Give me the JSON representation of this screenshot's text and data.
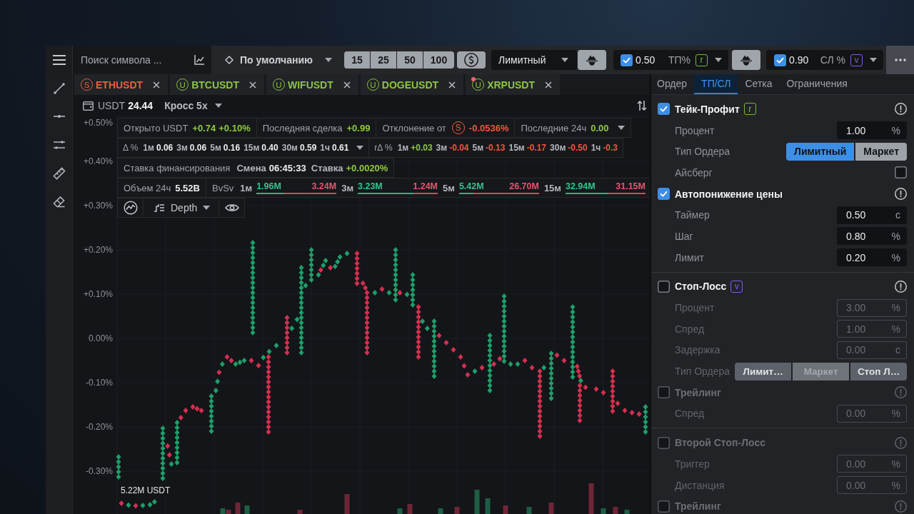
{
  "toolbar": {
    "search": {
      "placeholder": "Поиск символа ..."
    },
    "preset": {
      "label": "По умолчанию"
    },
    "leverage": [
      {
        "label": "15"
      },
      {
        "label": "25"
      },
      {
        "label": "50"
      },
      {
        "label": "100"
      }
    ],
    "order_type": {
      "value": "Лимитный"
    },
    "targets": [
      {
        "checked": true,
        "value": "0.50",
        "label": "ТП%",
        "key": "r",
        "color": "#74b83f"
      },
      {
        "checked": true,
        "value": "0.90",
        "label": "СЛ %",
        "key": "v",
        "color": "#7f5ee8"
      }
    ]
  },
  "chart_tabs": [
    {
      "market": "S",
      "symbol": "ETHUSDT",
      "color": "#f05d3b",
      "alert": false
    },
    {
      "market": "U",
      "symbol": "BTCUSDT",
      "color": "#8cc63e",
      "alert": false
    },
    {
      "market": "U",
      "symbol": "WIFUSDT",
      "color": "#8cc63e",
      "alert": false
    },
    {
      "market": "U",
      "symbol": "DOGEUSDT",
      "color": "#8cc63e",
      "alert": false
    },
    {
      "market": "U",
      "symbol": "XRPUSDT",
      "color": "#8cc63e",
      "alert": true
    }
  ],
  "chart": {
    "balance": {
      "currency": "USDT",
      "value": "24.44"
    },
    "margin_mode": "Кросс 5x",
    "stats": [
      [
        {
          "kind": "value",
          "label": "Открыто USDT",
          "values": [
            {
              "text": "+0.74",
              "kind": "up"
            },
            {
              "text": "+0.10%",
              "kind": "up"
            }
          ],
          "dropdown": false
        },
        {
          "kind": "value",
          "label": "Последняя сделка",
          "values": [
            {
              "text": "+0.99",
              "kind": "up"
            }
          ],
          "dropdown": false
        },
        {
          "kind": "value",
          "label": "Отклонение от",
          "market": "S",
          "values": [
            {
              "text": "-0.0536%",
              "kind": "down"
            }
          ],
          "dropdown": false
        },
        {
          "kind": "value",
          "label": "Последние 24ч",
          "values": [
            {
              "text": "0.00",
              "kind": "up"
            }
          ],
          "dropdown": true
        }
      ],
      [
        {
          "kind": "periods",
          "label": "Δ %",
          "items": [
            {
              "period": "1м",
              "value": "0.06",
              "kind": "flat"
            },
            {
              "period": "3м",
              "value": "0.06",
              "kind": "flat"
            },
            {
              "period": "5м",
              "value": "0.16",
              "kind": "flat"
            },
            {
              "period": "15м",
              "value": "0.40",
              "kind": "flat"
            },
            {
              "period": "30м",
              "value": "0.59",
              "kind": "flat"
            },
            {
              "period": "1ч",
              "value": "0.61",
              "kind": "flat"
            }
          ],
          "dropdown": true
        },
        {
          "kind": "periods",
          "label": "rΔ %",
          "items": [
            {
              "period": "1м",
              "value": "+0.03",
              "kind": "up"
            },
            {
              "period": "3м",
              "value": "-0.04",
              "kind": "down"
            },
            {
              "period": "5м",
              "value": "-0.13",
              "kind": "down"
            },
            {
              "period": "15м",
              "value": "-0.17",
              "kind": "down"
            },
            {
              "period": "30м",
              "value": "-0.50",
              "kind": "down"
            },
            {
              "period": "1ч",
              "value": "-0.3",
              "kind": "down"
            }
          ],
          "dropdown": false
        }
      ],
      [
        {
          "kind": "periods",
          "label": "Ставка финансирования",
          "items": [
            {
              "period": "Смена",
              "value": "06:45:33",
              "kind": "flat"
            },
            {
              "period": "Ставка",
              "value": "+0.0020%",
              "kind": "up"
            }
          ],
          "dropdown": false
        }
      ],
      [
        {
          "kind": "value",
          "label": "Объем 24ч",
          "values": [
            {
              "text": "5.52B",
              "kind": "flat"
            }
          ],
          "dropdown": false
        },
        {
          "kind": "ratio",
          "label": "BvSv",
          "items": [
            {
              "period": "1м",
              "buy": "1.96M",
              "sell": "3.24M",
              "level": 0.35
            },
            {
              "period": "3м",
              "buy": "3.23M",
              "sell": "1.24M",
              "level": 0.7
            },
            {
              "period": "5м",
              "buy": "5.42M",
              "sell": "26.70M",
              "level": 0.18
            },
            {
              "period": "15м",
              "buy": "32.94M",
              "sell": "31.15M",
              "level": 0.53
            }
          ],
          "dropdown": false
        }
      ]
    ],
    "view_mode": "Depth",
    "y_labels": [
      "+0.50%",
      "+0.40%",
      "+0.30%",
      "+0.20%",
      "+0.10%",
      "0.00%",
      "-0.10%",
      "-0.20%",
      "-0.30%"
    ],
    "volume_label": "5.22M USDT"
  },
  "order_panel": {
    "tabs": [
      {
        "label": "Ордер",
        "selected": false
      },
      {
        "label": "ТП/СЛ",
        "selected": true
      },
      {
        "label": "Сетка",
        "selected": false
      },
      {
        "label": "Ограничения",
        "selected": false
      }
    ],
    "sections": [
      {
        "rows": [
          {
            "kind": "header",
            "label": "Тейк-Профит",
            "checked": true,
            "disabled": false,
            "key": "r",
            "color": "#74b83f"
          },
          {
            "kind": "field",
            "label": "Процент",
            "value": "1.00",
            "unit": "%",
            "disabled": false
          },
          {
            "kind": "segmented",
            "label": "Тип Ордера",
            "disabled": false,
            "options": [
              {
                "label": "Лимитный",
                "selected": true
              },
              {
                "label": "Маркет",
                "selected": false
              }
            ]
          },
          {
            "kind": "checkbox",
            "label": "Айсберг",
            "checked": false,
            "disabled": false
          },
          {
            "kind": "header",
            "label": "Автопонижение цены",
            "checked": true,
            "disabled": false
          },
          {
            "kind": "field",
            "label": "Таймер",
            "value": "0.50",
            "unit": "с",
            "disabled": false
          },
          {
            "kind": "field",
            "label": "Шаг",
            "value": "0.80",
            "unit": "%",
            "disabled": false
          },
          {
            "kind": "field",
            "label": "Лимит",
            "value": "0.20",
            "unit": "%",
            "disabled": false
          }
        ]
      },
      {
        "rows": [
          {
            "kind": "header",
            "label": "Стоп-Лосс",
            "checked": false,
            "disabled": false,
            "key": "v",
            "color": "#7f5ee8"
          },
          {
            "kind": "field",
            "label": "Процент",
            "value": "3.00",
            "unit": "%",
            "disabled": true
          },
          {
            "kind": "field",
            "label": "Спред",
            "value": "1.00",
            "unit": "%",
            "disabled": true
          },
          {
            "kind": "field",
            "label": "Задержка",
            "value": "0.00",
            "unit": "с",
            "disabled": true
          },
          {
            "kind": "segmented",
            "label": "Тип Ордера",
            "disabled": true,
            "options": [
              {
                "label": "Лимит…",
                "selected": false
              },
              {
                "label": "Маркет",
                "selected": true
              },
              {
                "label": "Стоп Л…",
                "selected": false
              }
            ]
          },
          {
            "kind": "header",
            "label": "Трейлинг",
            "checked": false,
            "disabled": true
          },
          {
            "kind": "field",
            "label": "Спред",
            "value": "0.00",
            "unit": "%",
            "disabled": true
          }
        ]
      },
      {
        "rows": [
          {
            "kind": "header",
            "label": "Второй Стоп-Лосс",
            "checked": false,
            "disabled": true
          },
          {
            "kind": "field",
            "label": "Триггер",
            "value": "0.00",
            "unit": "%",
            "disabled": true
          },
          {
            "kind": "field",
            "label": "Дистанция",
            "value": "0.00",
            "unit": "%",
            "disabled": true
          },
          {
            "kind": "header",
            "label": "Трейлинг",
            "checked": false,
            "disabled": true
          }
        ]
      }
    ]
  }
}
